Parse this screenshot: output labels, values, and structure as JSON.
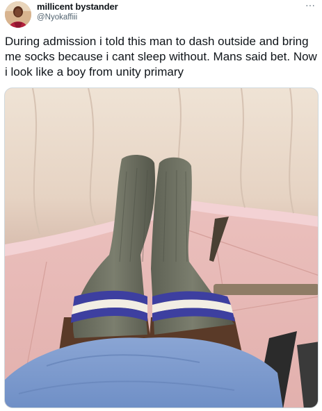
{
  "tweet": {
    "author_name": "millicent bystander",
    "author_handle": "@Nyokaffiii",
    "more_icon": "more-horizontal-icon",
    "text": "During admission i told this man to dash outside and bring me socks because i cant sleep without. Mans said bet. Now i look like a boy from unity primary"
  },
  "colors": {
    "text_primary": "#0f1419",
    "text_secondary": "#536471",
    "border": "#cfd9de"
  }
}
